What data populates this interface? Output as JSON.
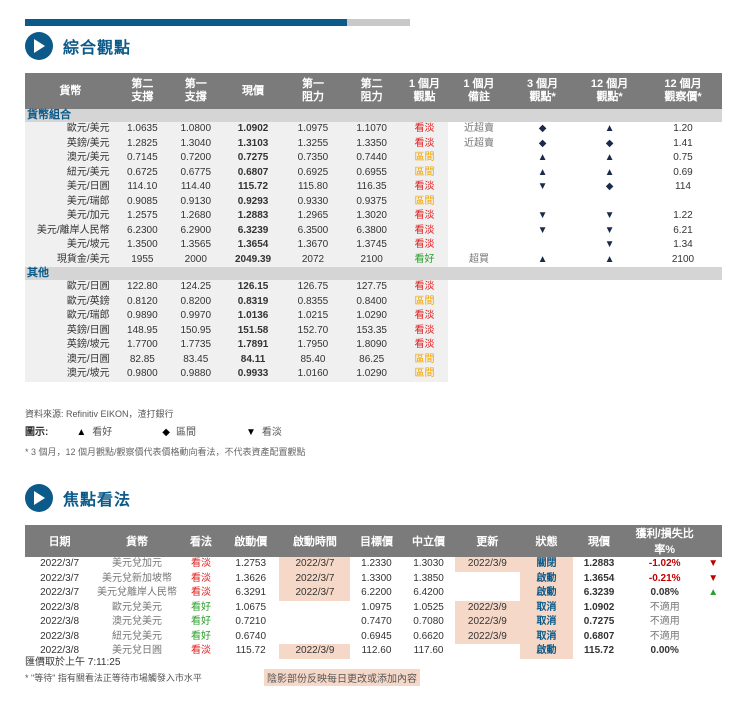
{
  "section1": {
    "title": "綜合觀點"
  },
  "section2": {
    "title": "焦點看法"
  },
  "table1": {
    "headers": [
      "貨幣",
      "第二\n支撐",
      "第一\n支撐",
      "現價",
      "第一\n阻力",
      "第二\n阻力",
      "1 個月\n觀點",
      "1 個月\n備註",
      "3 個月\n觀點*",
      "12 個月\n觀點*",
      "12 個月\n觀察價*"
    ],
    "groups": [
      {
        "name": "貨幣組合",
        "rows": [
          [
            "歐元/美元",
            "1.0635",
            "1.0800",
            "1.0902",
            "1.0975",
            "1.1070",
            "看淡",
            "近超賣",
            "◆",
            "▲",
            "1.20"
          ],
          [
            "英鎊/美元",
            "1.2825",
            "1.3040",
            "1.3103",
            "1.3255",
            "1.3350",
            "看淡",
            "近超賣",
            "◆",
            "◆",
            "1.41"
          ],
          [
            "澳元/美元",
            "0.7145",
            "0.7200",
            "0.7275",
            "0.7350",
            "0.7440",
            "區間",
            "",
            "▲",
            "▲",
            "0.75"
          ],
          [
            "紐元/美元",
            "0.6725",
            "0.6775",
            "0.6807",
            "0.6925",
            "0.6955",
            "區間",
            "",
            "▲",
            "▲",
            "0.69"
          ],
          [
            "美元/日圓",
            "114.10",
            "114.40",
            "115.72",
            "115.80",
            "116.35",
            "看淡",
            "",
            "▼",
            "◆",
            "114"
          ],
          [
            "美元/瑞郎",
            "0.9085",
            "0.9130",
            "0.9293",
            "0.9330",
            "0.9375",
            "區間",
            "",
            "",
            "",
            ""
          ],
          [
            "美元/加元",
            "1.2575",
            "1.2680",
            "1.2883",
            "1.2965",
            "1.3020",
            "看淡",
            "",
            "▼",
            "▼",
            "1.22"
          ],
          [
            "美元/離岸人民幣",
            "6.2300",
            "6.2900",
            "6.3239",
            "6.3500",
            "6.3800",
            "看淡",
            "",
            "▼",
            "▼",
            "6.21"
          ],
          [
            "美元/坡元",
            "1.3500",
            "1.3565",
            "1.3654",
            "1.3670",
            "1.3745",
            "看淡",
            "",
            "",
            "▼",
            "1.34"
          ],
          [
            "現貨金/美元",
            "1955",
            "2000",
            "2049.39",
            "2072",
            "2100",
            "看好",
            "超買",
            "▲",
            "▲",
            "2100"
          ]
        ]
      },
      {
        "name": "其他",
        "rows": [
          [
            "歐元/日圓",
            "122.80",
            "124.25",
            "126.15",
            "126.75",
            "127.75",
            "看淡",
            "",
            "",
            "",
            ""
          ],
          [
            "歐元/英鎊",
            "0.8120",
            "0.8200",
            "0.8319",
            "0.8355",
            "0.8400",
            "區間",
            "",
            "",
            "",
            ""
          ],
          [
            "歐元/瑞郎",
            "0.9890",
            "0.9970",
            "1.0136",
            "1.0215",
            "1.0290",
            "看淡",
            "",
            "",
            "",
            ""
          ],
          [
            "英鎊/日圓",
            "148.95",
            "150.95",
            "151.58",
            "152.70",
            "153.35",
            "看淡",
            "",
            "",
            "",
            ""
          ],
          [
            "英鎊/坡元",
            "1.7700",
            "1.7735",
            "1.7891",
            "1.7950",
            "1.8090",
            "看淡",
            "",
            "",
            "",
            ""
          ],
          [
            "澳元/日圓",
            "82.85",
            "83.45",
            "84.11",
            "85.40",
            "86.25",
            "區間",
            "",
            "",
            "",
            ""
          ],
          [
            "澳元/坡元",
            "0.9800",
            "0.9880",
            "0.9933",
            "1.0160",
            "1.0290",
            "區間",
            "",
            "",
            "",
            ""
          ]
        ]
      }
    ]
  },
  "source": "資料來源: Refinitiv EIKON，渣打銀行",
  "legend": {
    "label": "圖示:",
    "items": [
      {
        "symbol": "▲",
        "text": "看好"
      },
      {
        "symbol": "◆",
        "text": "區間"
      },
      {
        "symbol": "▼",
        "text": "看淡"
      }
    ]
  },
  "note1": "* 3 個月，12 個月觀點/觀察價代表價格動向看法，不代表資產配置觀點",
  "table2": {
    "headers": [
      "日期",
      "貨幣",
      "看法",
      "啟動價",
      "啟動時間",
      "目標價",
      "中立價",
      "更新",
      "狀態",
      "現價",
      "獲利/損失比率%",
      ""
    ],
    "rows": [
      [
        "2022/3/7",
        "美元兌加元",
        "看淡",
        "1.2753",
        "2022/3/7",
        "1.2330",
        "1.3030",
        "2022/3/9",
        "關閉",
        "1.2883",
        "-1.02%",
        "▼"
      ],
      [
        "2022/3/7",
        "美元兌新加坡幣",
        "看淡",
        "1.3626",
        "2022/3/7",
        "1.3300",
        "1.3850",
        "",
        "啟動",
        "1.3654",
        "-0.21%",
        "▼"
      ],
      [
        "2022/3/7",
        "美元兌離岸人民幣",
        "看淡",
        "6.3291",
        "2022/3/7",
        "6.2200",
        "6.4200",
        "",
        "啟動",
        "6.3239",
        "0.08%",
        "▲"
      ],
      [
        "2022/3/8",
        "歐元兌美元",
        "看好",
        "1.0675",
        "",
        "1.0975",
        "1.0525",
        "2022/3/9",
        "取消",
        "1.0902",
        "不適用",
        ""
      ],
      [
        "2022/3/8",
        "澳元兌美元",
        "看好",
        "0.7210",
        "",
        "0.7470",
        "0.7080",
        "2022/3/9",
        "取消",
        "0.7275",
        "不適用",
        ""
      ],
      [
        "2022/3/8",
        "紐元兌美元",
        "看好",
        "0.6740",
        "",
        "0.6945",
        "0.6620",
        "2022/3/9",
        "取消",
        "0.6807",
        "不適用",
        ""
      ],
      [
        "2022/3/8",
        "美元兌日圓",
        "看淡",
        "115.72",
        "2022/3/9",
        "112.60",
        "117.60",
        "",
        "啟動",
        "115.72",
        "0.00%",
        ""
      ]
    ]
  },
  "timestamp": "匯價取於上午 7:11:25",
  "note2": "* \"等待\" 指有關看法正等待市場觸發入市水平",
  "note3": "陰影部份反映每日更改或添加內容",
  "colors": {
    "accent": "#0b5a8a",
    "bearish": "#e02020",
    "range": "#f0a500",
    "bullish": "#2ca02c",
    "highlight": "#f6d8c8"
  }
}
